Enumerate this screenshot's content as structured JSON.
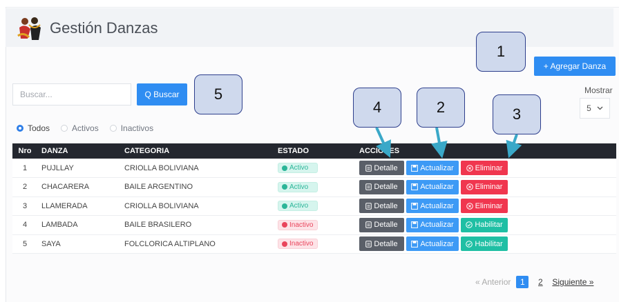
{
  "header": {
    "title": "Gestión Danzas"
  },
  "toolbar": {
    "add_label": "+ Agregar Danza",
    "search_placeholder": "Buscar...",
    "search_label": "Q Buscar",
    "mostrar_label": "Mostrar",
    "page_size": "5"
  },
  "filters": {
    "todos": "Todos",
    "activos": "Activos",
    "inactivos": "Inactivos"
  },
  "table": {
    "columns": [
      "Nro",
      "DANZA",
      "CATEGORIA",
      "ESTADO",
      "ACCIONES"
    ],
    "rows": [
      {
        "nro": "1",
        "danza": "PUJLLAY",
        "categoria": "CRIOLLA BOLIVIANA",
        "estado": "Activo",
        "accion3": "Eliminar"
      },
      {
        "nro": "2",
        "danza": "CHACARERA",
        "categoria": "BAILE ARGENTINO",
        "estado": "Activo",
        "accion3": "Eliminar"
      },
      {
        "nro": "3",
        "danza": "LLAMERADA",
        "categoria": "CRIOLLA BOLIVIANA",
        "estado": "Activo",
        "accion3": "Eliminar"
      },
      {
        "nro": "4",
        "danza": "LAMBADA",
        "categoria": "BAILE BRASILERO",
        "estado": "Inactivo",
        "accion3": "Habilitar"
      },
      {
        "nro": "5",
        "danza": "SAYA",
        "categoria": "FOLCLORICA ALTIPLANO",
        "estado": "Inactivo",
        "accion3": "Habilitar"
      }
    ],
    "detalle_label": "Detalle",
    "actualizar_label": "Actualizar"
  },
  "pagination": {
    "prev": "« Anterior",
    "page1": "1",
    "page2": "2",
    "next": "Siguiente »"
  },
  "callouts": {
    "c1": "1",
    "c2": "2",
    "c3": "3",
    "c4": "4",
    "c5": "5"
  },
  "colors": {
    "primary": "#2f8df2",
    "danger": "#f0364f",
    "success": "#1fbfa4",
    "dark": "#24272f"
  }
}
